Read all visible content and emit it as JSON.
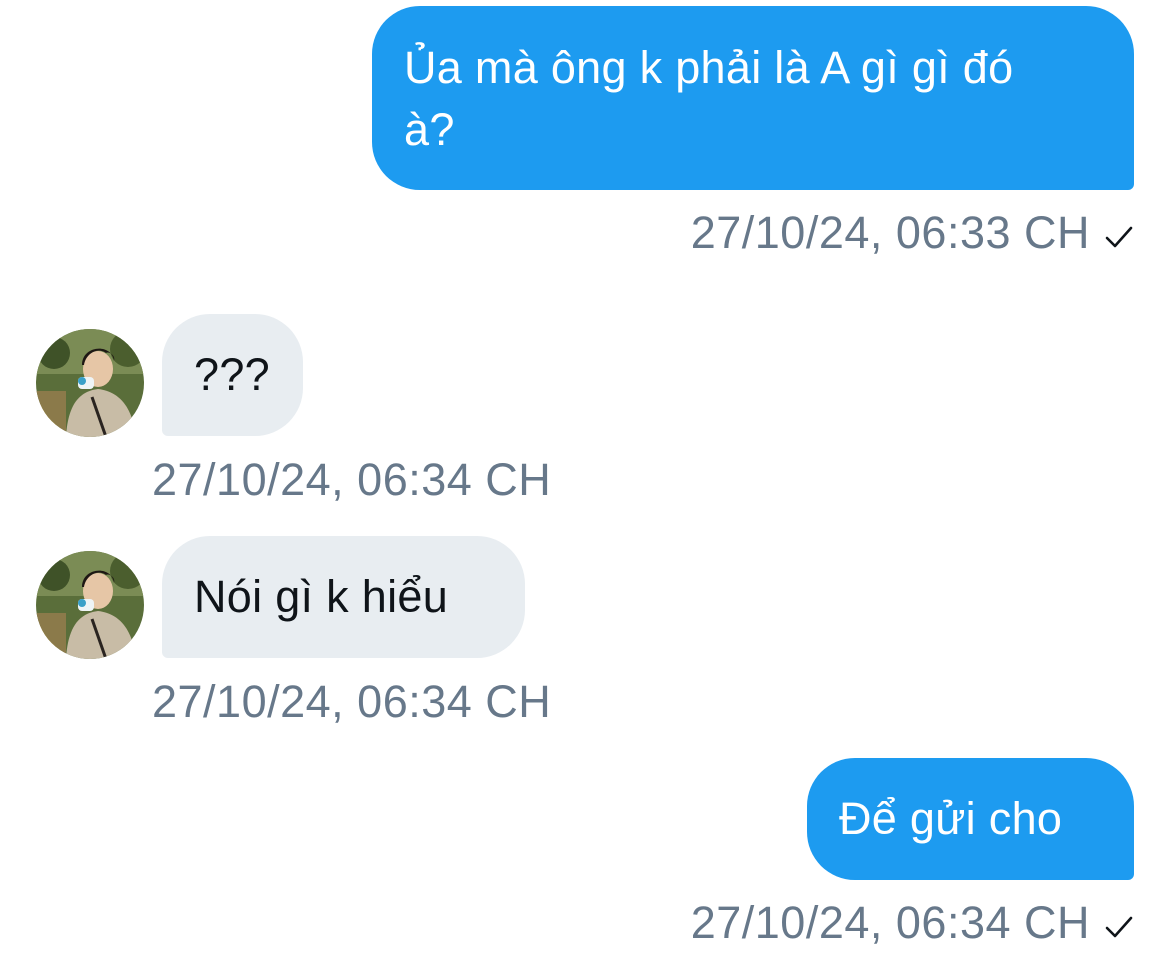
{
  "messages": [
    {
      "direction": "sent",
      "text": "Ủa mà ông k phải là A gì gì đó à?",
      "timestamp": "27/10/24, 06:33 CH",
      "read_icon": "check-icon"
    },
    {
      "direction": "received",
      "text": "???",
      "timestamp": "27/10/24, 06:34 CH",
      "avatar": "profile-photo"
    },
    {
      "direction": "received",
      "text": "Nói gì k hiểu",
      "timestamp": "27/10/24, 06:34 CH",
      "avatar": "profile-photo"
    },
    {
      "direction": "sent",
      "text": "Để gửi cho",
      "timestamp": "27/10/24, 06:34 CH",
      "read_icon": "check-icon"
    }
  ],
  "colors": {
    "sent_bubble": "#1d9bf0",
    "received_bubble": "#e8edf1",
    "timestamp": "#67788a"
  }
}
